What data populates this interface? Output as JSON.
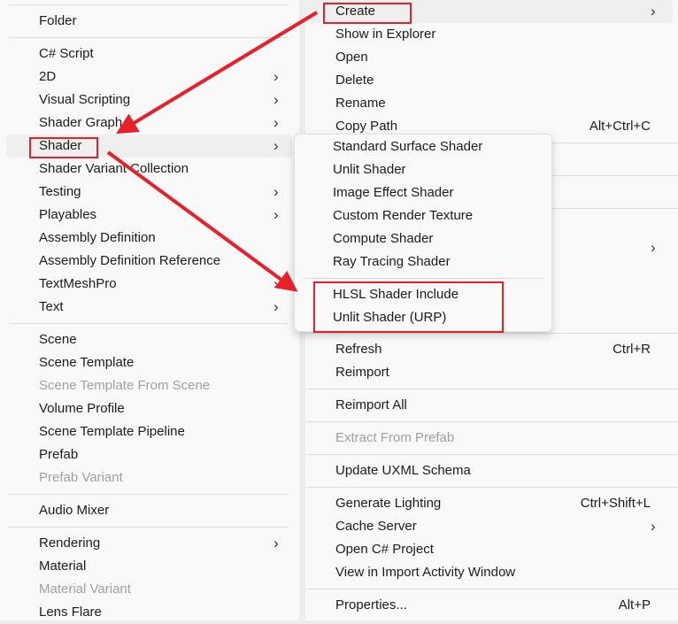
{
  "left_menu": [
    {
      "type": "sep"
    },
    {
      "label": "Folder"
    },
    {
      "type": "sep"
    },
    {
      "label": "C# Script"
    },
    {
      "label": "2D",
      "submenu": true
    },
    {
      "label": "Visual Scripting",
      "submenu": true
    },
    {
      "label": "Shader Graph",
      "submenu": true
    },
    {
      "label": "Shader",
      "submenu": true,
      "highlighted": true
    },
    {
      "label": "Shader Variant Collection"
    },
    {
      "label": "Testing",
      "submenu": true
    },
    {
      "label": "Playables",
      "submenu": true
    },
    {
      "label": "Assembly Definition"
    },
    {
      "label": "Assembly Definition Reference"
    },
    {
      "label": "TextMeshPro",
      "submenu": true
    },
    {
      "label": "Text",
      "submenu": true
    },
    {
      "type": "sep"
    },
    {
      "label": "Scene"
    },
    {
      "label": "Scene Template"
    },
    {
      "label": "Scene Template From Scene",
      "disabled": true
    },
    {
      "label": "Volume Profile"
    },
    {
      "label": "Scene Template Pipeline"
    },
    {
      "label": "Prefab"
    },
    {
      "label": "Prefab Variant",
      "disabled": true
    },
    {
      "type": "sep"
    },
    {
      "label": "Audio Mixer"
    },
    {
      "type": "sep"
    },
    {
      "label": "Rendering",
      "submenu": true
    },
    {
      "label": "Material"
    },
    {
      "label": "Material Variant",
      "disabled": true
    },
    {
      "label": "Lens Flare"
    }
  ],
  "right_menu": [
    {
      "label": "Create",
      "submenu": true,
      "highlighted": true
    },
    {
      "label": "Show in Explorer"
    },
    {
      "label": "Open"
    },
    {
      "label": "Delete"
    },
    {
      "label": "Rename"
    },
    {
      "label": "Copy Path",
      "shortcut": "Alt+Ctrl+C"
    },
    {
      "type": "sep"
    },
    {
      "label": ""
    },
    {
      "type": "sep"
    },
    {
      "label": ""
    },
    {
      "type": "sep"
    },
    {
      "label": ""
    },
    {
      "label": "",
      "submenu": true
    },
    {
      "label": ""
    },
    {
      "label": ""
    },
    {
      "label": ""
    },
    {
      "type": "sep"
    },
    {
      "label": "Refresh",
      "shortcut": "Ctrl+R"
    },
    {
      "label": "Reimport"
    },
    {
      "type": "sep"
    },
    {
      "label": "Reimport All"
    },
    {
      "type": "sep"
    },
    {
      "label": "Extract From Prefab",
      "disabled": true
    },
    {
      "type": "sep"
    },
    {
      "label": "Update UXML Schema"
    },
    {
      "type": "sep"
    },
    {
      "label": "Generate Lighting",
      "shortcut": "Ctrl+Shift+L"
    },
    {
      "label": "Cache Server",
      "submenu": true
    },
    {
      "label": "Open C# Project"
    },
    {
      "label": "View in Import Activity Window"
    },
    {
      "type": "sep"
    },
    {
      "label": "Properties...",
      "shortcut": "Alt+P"
    }
  ],
  "shader_submenu": [
    {
      "label": "Standard Surface Shader"
    },
    {
      "label": "Unlit Shader"
    },
    {
      "label": "Image Effect Shader"
    },
    {
      "label": "Custom Render Texture"
    },
    {
      "label": "Compute Shader"
    },
    {
      "label": "Ray Tracing Shader"
    },
    {
      "type": "sep"
    },
    {
      "label": "HLSL Shader Include"
    },
    {
      "label": "Unlit Shader (URP)"
    }
  ],
  "icons": {
    "submenu_arrow": "chevron-right-icon"
  },
  "annotation_color": "#e8202a"
}
